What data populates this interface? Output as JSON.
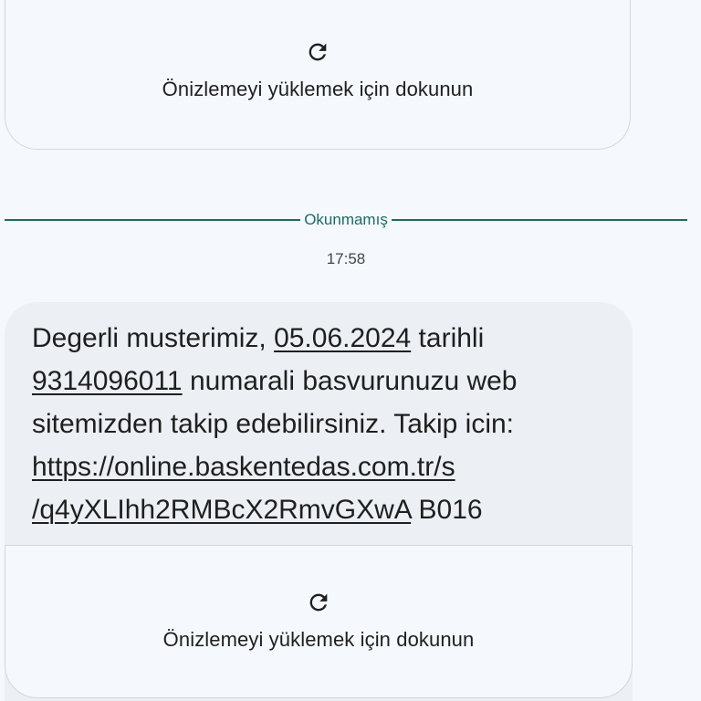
{
  "top_preview": {
    "icon": "reload-icon",
    "label": "Önizlemeyi yüklemek için dokunun"
  },
  "divider": {
    "label": "Okunmamış"
  },
  "timestamp": "17:58",
  "message": {
    "lines": [
      {
        "prefix": "Degerli musterimiz, ",
        "link": "05.06.2024",
        "suffix": " tarihli"
      },
      {
        "prefix": "",
        "link": "9314096011",
        "suffix": " numarali basvurunuzu web"
      },
      {
        "prefix": "sitemizden takip edebilirsiniz. Takip icin:",
        "link": "",
        "suffix": ""
      },
      {
        "prefix": "",
        "link": "https://online.baskentedas.com.tr/s",
        "suffix": ""
      },
      {
        "prefix": "",
        "link": "/q4yXLIhh2RMBcX2RmvGXwA",
        "suffix": " B016"
      }
    ]
  },
  "bottom_preview": {
    "icon": "reload-icon",
    "label": "Önizlemeyi yüklemek için dokunun"
  },
  "colors": {
    "background": "#f5f8fd",
    "bubble": "#eceff4",
    "accent": "#1d6b62",
    "border": "#d3d6db"
  }
}
